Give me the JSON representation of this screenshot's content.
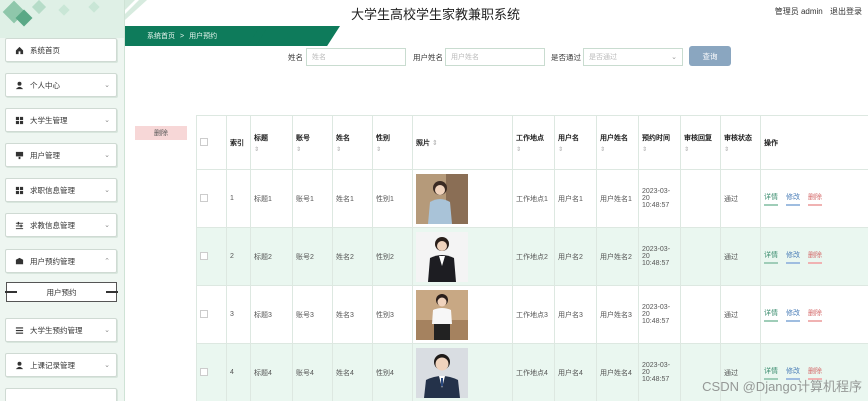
{
  "header": {
    "title": "大学生高校学生家教兼职系统",
    "user_label": "管理员 admin",
    "logout": "退出登录"
  },
  "breadcrumb": {
    "home": "系统首页",
    "separator": ">",
    "current": "用户预约"
  },
  "sidebar": {
    "items": [
      {
        "label": "系统首页",
        "icon": "home-icon"
      },
      {
        "label": "个人中心",
        "icon": "user-icon"
      },
      {
        "label": "大学生管理",
        "icon": "grid-icon"
      },
      {
        "label": "用户管理",
        "icon": "monitor-icon"
      },
      {
        "label": "求职信息管理",
        "icon": "grid-icon"
      },
      {
        "label": "求教信息管理",
        "icon": "sliders-icon"
      },
      {
        "label": "用户预约管理",
        "icon": "id-card-icon"
      },
      {
        "label": "大学生预约管理",
        "icon": "list-icon"
      },
      {
        "label": "上课记录管理",
        "icon": "user-icon"
      }
    ],
    "sub_item": "用户预约"
  },
  "search": {
    "name_label": "姓名",
    "name_placeholder": "姓名",
    "username_label": "用户姓名",
    "username_placeholder": "用户姓名",
    "approved_label": "是否通过",
    "approved_placeholder": "是否通过",
    "button": "查询"
  },
  "delete_button": "删除",
  "table": {
    "headers": [
      "索引",
      "标题",
      "账号",
      "姓名",
      "性别",
      "照片",
      "工作地点",
      "用户名",
      "用户姓名",
      "预约时间",
      "审核回复",
      "审核状态",
      "操作"
    ],
    "rows": [
      {
        "index": "1",
        "title": "标题1",
        "account": "账号1",
        "name": "姓名1",
        "gender": "性别1",
        "location": "工作地点1",
        "username": "用户名1",
        "user_name": "用户姓名1",
        "time": "2023-03-20 10:48:57",
        "reply": "",
        "status": "通过"
      },
      {
        "index": "2",
        "title": "标题2",
        "account": "账号2",
        "name": "姓名2",
        "gender": "性别2",
        "location": "工作地点2",
        "username": "用户名2",
        "user_name": "用户姓名2",
        "time": "2023-03-20 10:48:57",
        "reply": "",
        "status": "通过"
      },
      {
        "index": "3",
        "title": "标题3",
        "account": "账号3",
        "name": "姓名3",
        "gender": "性别3",
        "location": "工作地点3",
        "username": "用户名3",
        "user_name": "用户姓名3",
        "time": "2023-03-20 10:48:57",
        "reply": "",
        "status": "通过"
      },
      {
        "index": "4",
        "title": "标题4",
        "account": "账号4",
        "name": "姓名4",
        "gender": "性别4",
        "location": "工作地点4",
        "username": "用户名4",
        "user_name": "用户姓名4",
        "time": "2023-03-20 10:48:57",
        "reply": "",
        "status": "通过"
      }
    ],
    "actions": {
      "detail": "详情",
      "edit": "修改",
      "delete": "删除"
    }
  },
  "watermark": "CSDN @Django计算机程序",
  "colors": {
    "brand": "#0e7b5b",
    "row_alt": "#eaf7f0",
    "search_button": "#8aa6c0"
  }
}
